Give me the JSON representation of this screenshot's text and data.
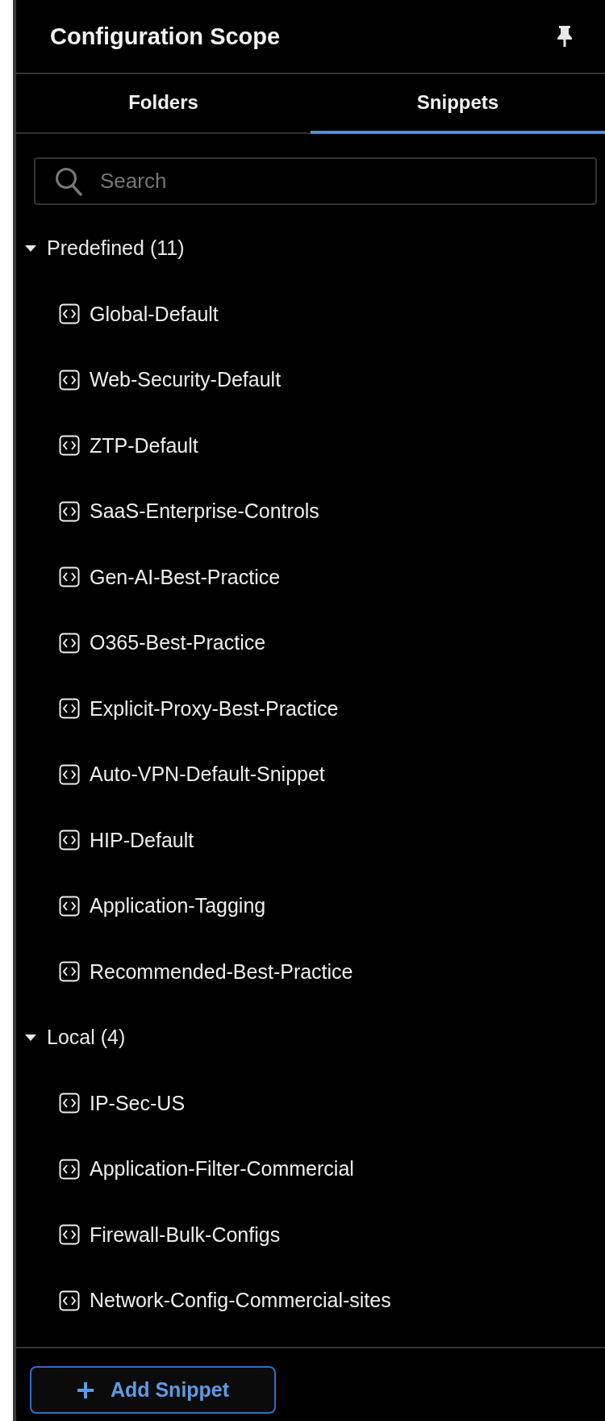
{
  "title": "Configuration Scope",
  "tabs": [
    {
      "label": "Folders",
      "selected": false
    },
    {
      "label": "Snippets",
      "selected": true
    }
  ],
  "search": {
    "placeholder": "Search"
  },
  "groups": [
    {
      "label": "Predefined",
      "count": "(11)",
      "expanded": true,
      "children": [
        {
          "label": "Global-Default"
        },
        {
          "label": "Web-Security-Default"
        },
        {
          "label": "ZTP-Default"
        },
        {
          "label": "SaaS-Enterprise-Controls"
        },
        {
          "label": "Gen-AI-Best-Practice"
        },
        {
          "label": "O365-Best-Practice"
        },
        {
          "label": "Explicit-Proxy-Best-Practice"
        },
        {
          "label": "Auto-VPN-Default-Snippet"
        },
        {
          "label": "HIP-Default"
        },
        {
          "label": "Application-Tagging"
        },
        {
          "label": "Recommended-Best-Practice"
        }
      ]
    },
    {
      "label": "Local",
      "count": "(4)",
      "expanded": true,
      "children": [
        {
          "label": "IP-Sec-US"
        },
        {
          "label": "Application-Filter-Commercial"
        },
        {
          "label": "Firewall-Bulk-Configs"
        },
        {
          "label": "Network-Config-Commercial-sites"
        }
      ]
    }
  ],
  "add_button": "Add Snippet"
}
